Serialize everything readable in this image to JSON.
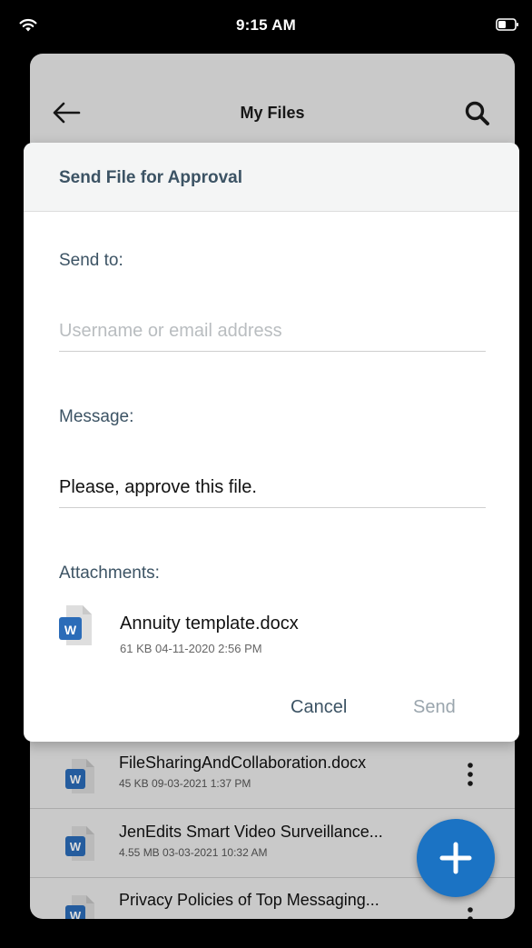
{
  "status_bar": {
    "time": "9:15 AM"
  },
  "app_bar": {
    "title": "My Files"
  },
  "files": [
    {
      "name": "FileSharingAndCollaboration.docx",
      "meta": "45 KB 09-03-2021 1:37 PM",
      "icon": "word-file-icon"
    },
    {
      "name": "JenEdits Smart Video Surveillance...",
      "meta": "4.55 MB 03-03-2021 10:32 AM",
      "icon": "word-file-icon"
    },
    {
      "name": "Privacy Policies of Top Messaging...",
      "meta": "",
      "icon": "word-file-icon"
    }
  ],
  "dialog": {
    "title": "Send File for Approval",
    "send_to_label": "Send to:",
    "send_to_placeholder": "Username or email address",
    "message_label": "Message:",
    "message_value": "Please, approve this file.",
    "attachments_label": "Attachments:",
    "attachment": {
      "name": "Annuity template.docx",
      "meta": "61 KB 04-11-2020 2:56 PM",
      "icon": "word-file-icon",
      "badge": "W"
    },
    "cancel_label": "Cancel",
    "send_label": "Send"
  },
  "colors": {
    "accent": "#1b73c4",
    "dialog_text": "#3c5364",
    "send_disabled": "#9aa5ad",
    "word_blue": "#2b6cb8"
  }
}
